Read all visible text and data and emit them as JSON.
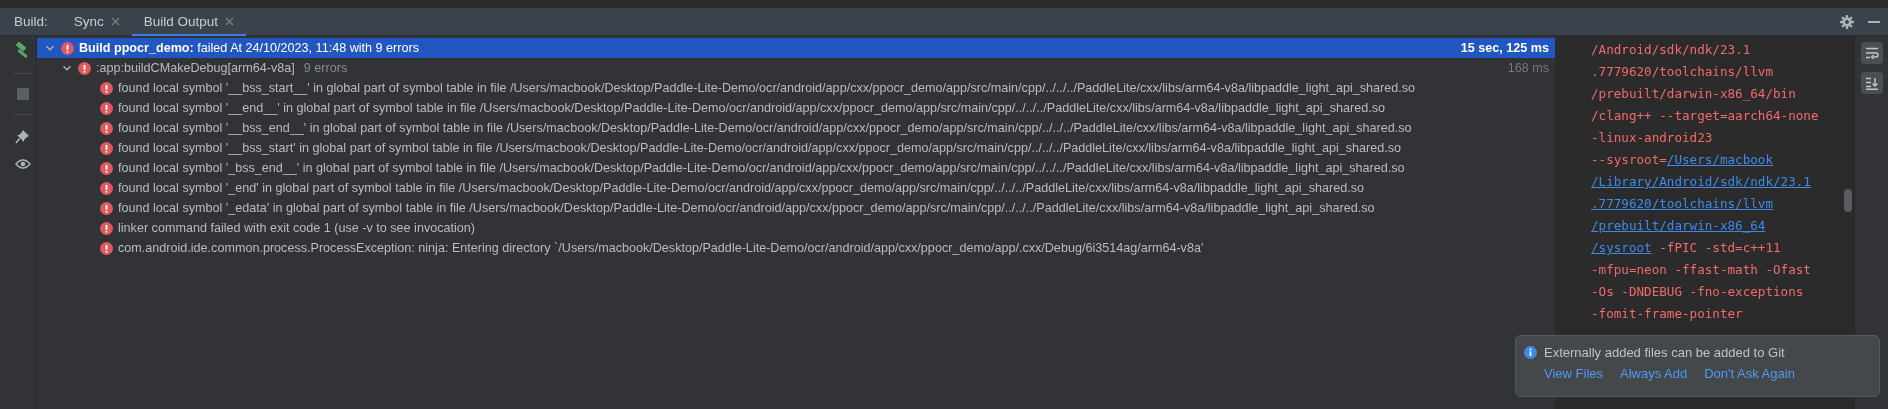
{
  "tool_window": {
    "title": "Build:"
  },
  "tabs": [
    {
      "label": "Sync",
      "selected": false
    },
    {
      "label": "Build Output",
      "selected": true
    }
  ],
  "build_tree": {
    "title": "**Build ppocr_demo:** failed At 24/10/2023, 11:48 with 9 errors",
    "time": "15 sec, 125 ms",
    "expanded": true,
    "selected": true,
    "children": [
      {
        "label": ":app:buildCMakeDebug[arm64-v8a]",
        "count": "9 errors",
        "time": "168 ms",
        "expanded": true,
        "selected": false,
        "children": [
          {
            "text": "found local symbol '__bss_start__' in global part of symbol table in file /Users/macbook/Desktop/Paddle-Lite-Demo/ocr/android/app/cxx/ppocr_demo/app/src/main/cpp/../../../PaddleLite/cxx/libs/arm64-v8a/libpaddle_light_api_shared.so"
          },
          {
            "text": "found local symbol '__end__' in global part of symbol table in file /Users/macbook/Desktop/Paddle-Lite-Demo/ocr/android/app/cxx/ppocr_demo/app/src/main/cpp/../../../PaddleLite/cxx/libs/arm64-v8a/libpaddle_light_api_shared.so"
          },
          {
            "text": "found local symbol '__bss_end__' in global part of symbol table in file /Users/macbook/Desktop/Paddle-Lite-Demo/ocr/android/app/cxx/ppocr_demo/app/src/main/cpp/../../../PaddleLite/cxx/libs/arm64-v8a/libpaddle_light_api_shared.so"
          },
          {
            "text": "found local symbol '__bss_start' in global part of symbol table in file /Users/macbook/Desktop/Paddle-Lite-Demo/ocr/android/app/cxx/ppocr_demo/app/src/main/cpp/../../../PaddleLite/cxx/libs/arm64-v8a/libpaddle_light_api_shared.so"
          },
          {
            "text": "found local symbol '_bss_end__' in global part of symbol table in file /Users/macbook/Desktop/Paddle-Lite-Demo/ocr/android/app/cxx/ppocr_demo/app/src/main/cpp/../../../PaddleLite/cxx/libs/arm64-v8a/libpaddle_light_api_shared.so"
          },
          {
            "text": "found local symbol '_end' in global part of symbol table in file /Users/macbook/Desktop/Paddle-Lite-Demo/ocr/android/app/cxx/ppocr_demo/app/src/main/cpp/../../../PaddleLite/cxx/libs/arm64-v8a/libpaddle_light_api_shared.so"
          },
          {
            "text": "found local symbol '_edata' in global part of symbol table in file /Users/macbook/Desktop/Paddle-Lite-Demo/ocr/android/app/cxx/ppocr_demo/app/src/main/cpp/../../../PaddleLite/cxx/libs/arm64-v8a/libpaddle_light_api_shared.so"
          },
          {
            "text": "linker command failed with exit code 1 (use -v to see invocation)"
          },
          {
            "text": "com.android.ide.common.process.ProcessException: ninja: Entering directory `/Users/macbook/Desktop/Paddle-Lite-Demo/ocr/android/app/cxx/ppocr_demo/app/.cxx/Debug/6i3514ag/arm64-v8a'"
          }
        ]
      }
    ]
  },
  "console_lines": [
    [
      {
        "text": "/Android/sdk/ndk/23.1",
        "kind": "text"
      }
    ],
    [
      {
        "text": ".7779620/toolchains/llvm",
        "kind": "text"
      }
    ],
    [
      {
        "text": "/prebuilt/darwin-x86_64/bin",
        "kind": "text"
      }
    ],
    [
      {
        "text": "/clang++ --target=aarch64-none",
        "kind": "text"
      }
    ],
    [
      {
        "text": "-linux-android23",
        "kind": "text"
      }
    ],
    [
      {
        "text": "--sysroot=",
        "kind": "text"
      },
      {
        "text": "/Users/macbook",
        "kind": "link"
      }
    ],
    [
      {
        "text": "/Library/Android/sdk/ndk/23.1",
        "kind": "link"
      }
    ],
    [
      {
        "text": ".7779620/toolchains/llvm",
        "kind": "link"
      }
    ],
    [
      {
        "text": "/prebuilt/darwin-x86_64",
        "kind": "link"
      }
    ],
    [
      {
        "text": "/sysroot",
        "kind": "link"
      },
      {
        "text": " -fPIC -std=c++11",
        "kind": "text"
      }
    ],
    [
      {
        "text": "-mfpu=neon -ffast-math -Ofast",
        "kind": "text"
      }
    ],
    [
      {
        "text": "-Os -DNDEBUG -fno-exceptions",
        "kind": "text"
      }
    ],
    [
      {
        "text": "-fomit-frame-pointer",
        "kind": "text"
      }
    ]
  ],
  "notification": {
    "message": "Externally added files can be added to Git",
    "actions": [
      "View Files",
      "Always Add",
      "Don't Ask Again"
    ]
  }
}
